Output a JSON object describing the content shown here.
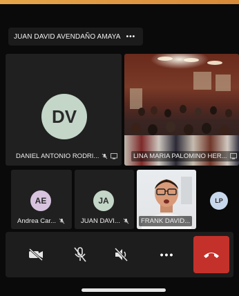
{
  "presenter": {
    "name": "JUAN DAVID AVENDAÑO AMAYA",
    "more_label": "•••"
  },
  "tiles": {
    "daniel": {
      "initials": "DV",
      "name": "DANIEL ANTONIO RODRI...",
      "avatar_color": "#c3d6c8"
    },
    "lina": {
      "name": "LINA MARIA PALOMINO HER..."
    },
    "andrea": {
      "initials": "AE",
      "name": "Andrea Car...",
      "avatar_color": "#d8c3df"
    },
    "juan": {
      "initials": "JA",
      "name": "JUAN DAVI...",
      "avatar_color": "#c3d6c8"
    },
    "frank": {
      "name": "FRANK DAVID..."
    },
    "lp": {
      "initials": "LP",
      "avatar_color": "#c8d8ec"
    }
  },
  "controls": {
    "camera": "camera-off-icon",
    "mic": "mic-off-icon",
    "speaker": "speaker-off-icon",
    "more": "•••",
    "end": "end-call-icon",
    "end_color": "#c4312b"
  }
}
